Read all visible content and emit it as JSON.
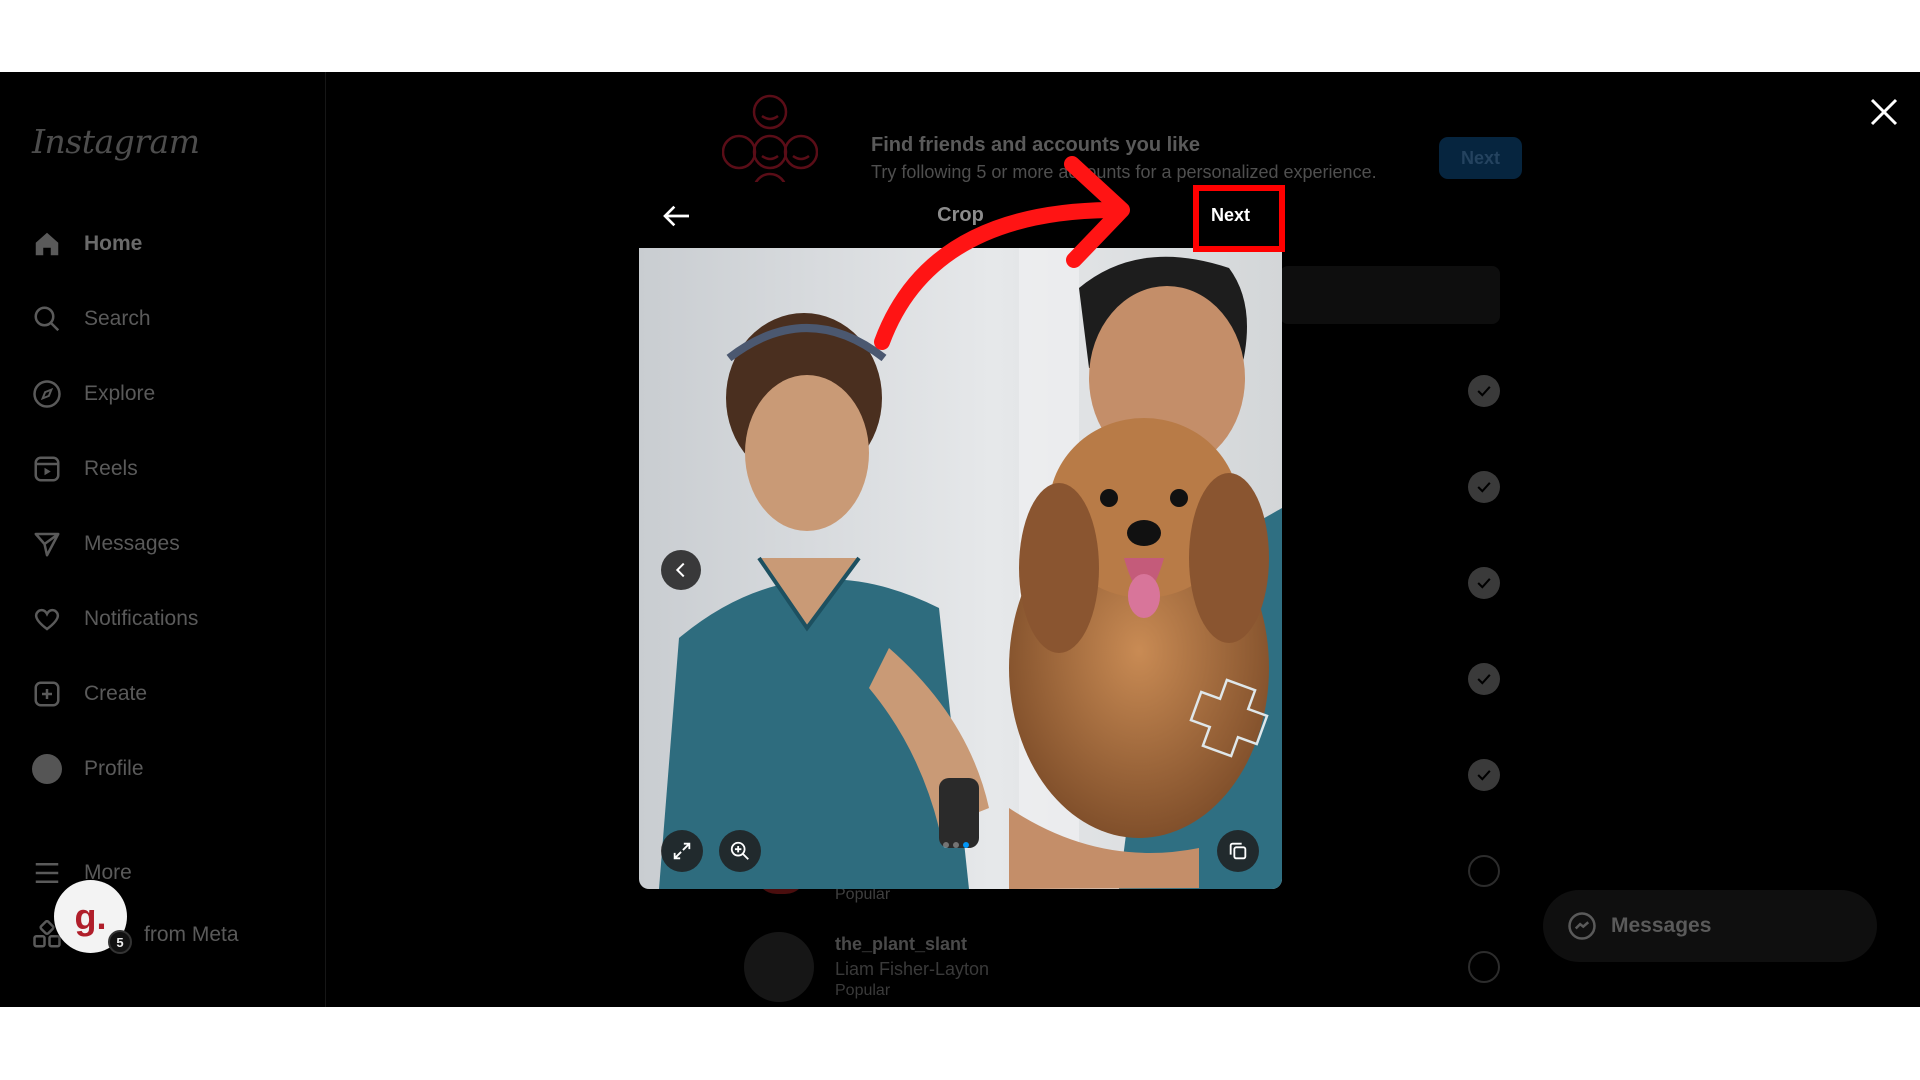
{
  "sidebar": {
    "logo": "Instagram",
    "items": [
      {
        "label": "Home",
        "icon": "home-icon"
      },
      {
        "label": "Search",
        "icon": "search-icon"
      },
      {
        "label": "Explore",
        "icon": "compass-icon"
      },
      {
        "label": "Reels",
        "icon": "reels-icon"
      },
      {
        "label": "Messages",
        "icon": "send-icon"
      },
      {
        "label": "Notifications",
        "icon": "heart-icon"
      },
      {
        "label": "Create",
        "icon": "plus-square-icon"
      },
      {
        "label": "Profile",
        "icon": "avatar"
      },
      {
        "label": "More",
        "icon": "menu-icon"
      }
    ],
    "meta_label": "from Meta",
    "badge_letter": "g.",
    "badge_count": "5"
  },
  "banner": {
    "title": "Find friends and accounts you like",
    "subtitle": "Try following 5 or more accounts for a personalized experience.",
    "next_label": "Next"
  },
  "suggestions": {
    "row1_popular": "Popular",
    "row2_username": "the_plant_slant",
    "row2_name": "Liam Fisher-Layton",
    "row2_popular": "Popular"
  },
  "crop_dialog": {
    "title": "Crop",
    "next_label": "Next"
  },
  "messages_pill": {
    "label": "Messages"
  },
  "colors": {
    "highlight": "#ff0000",
    "accent": "#0095f6"
  }
}
